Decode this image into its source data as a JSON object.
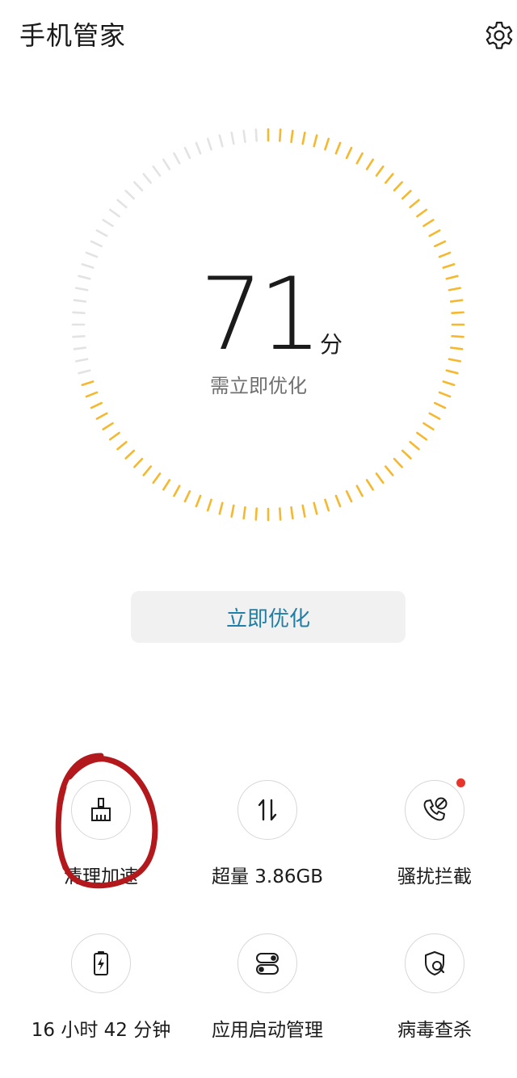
{
  "header": {
    "title": "手机管家",
    "settings_icon": "gear-icon"
  },
  "score": {
    "value": "71",
    "unit": "分",
    "status": "需立即优化",
    "progress_fraction": 0.71,
    "colors": {
      "active": "#f5b82e",
      "inactive": "#e3e3e3"
    }
  },
  "optimize_button": {
    "label": "立即优化",
    "color": "#1f7fa6"
  },
  "tools": [
    {
      "label": "清理加速",
      "icon": "broom-icon"
    },
    {
      "label": "超量 3.86GB",
      "icon": "data-transfer-icon"
    },
    {
      "label": "骚扰拦截",
      "icon": "phone-block-icon",
      "badge": true,
      "badge_color": "#e8342a"
    },
    {
      "label": "16 小时 42 分钟",
      "icon": "battery-icon"
    },
    {
      "label": "应用启动管理",
      "icon": "toggles-icon"
    },
    {
      "label": "病毒查杀",
      "icon": "shield-search-icon"
    }
  ],
  "annotation": {
    "color": "#b3191c"
  }
}
